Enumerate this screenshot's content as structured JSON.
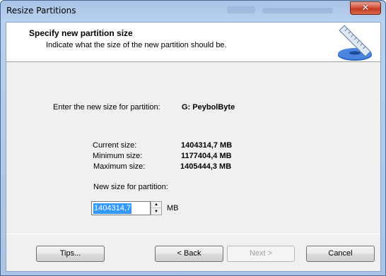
{
  "window": {
    "title": "Resize Partitions",
    "close_glyph": "✕"
  },
  "header": {
    "title": "Specify new partition size",
    "subtitle": "Indicate what the size of the new partition should be.",
    "icon": "ruler-disk-icon"
  },
  "partition": {
    "prompt_label": "Enter the new size for partition:",
    "name": "G: PeybolByte"
  },
  "sizes": {
    "current_label": "Current size:",
    "current_value": "1404314,7 MB",
    "minimum_label": "Minimum size:",
    "minimum_value": "1177404,4 MB",
    "maximum_label": "Maximum size:",
    "maximum_value": "1405444,3 MB"
  },
  "new_size": {
    "label": "New size for partition:",
    "value": "1404314,7",
    "unit": "MB"
  },
  "buttons": {
    "tips": "Tips...",
    "back": "< Back",
    "next": "Next >",
    "cancel": "Cancel"
  }
}
